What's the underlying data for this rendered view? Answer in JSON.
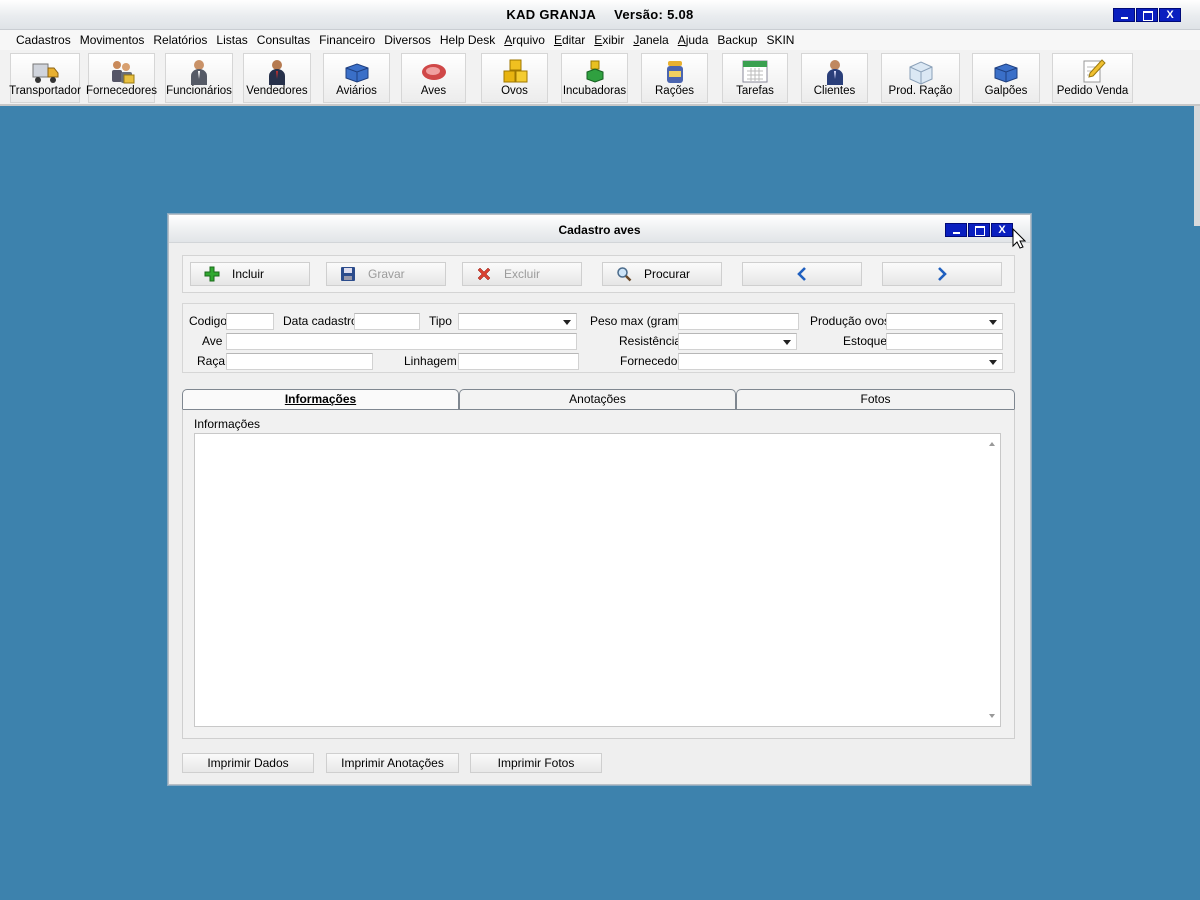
{
  "app": {
    "name": "KAD GRANJA",
    "version": "Versão: 5.08",
    "minimize_icon": "minimize-icon",
    "maximize_icon": "maximize-icon",
    "close_glyph": "X"
  },
  "menu": [
    "Cadastros",
    "Movimentos",
    "Relatórios",
    "Listas",
    "Consultas",
    "Financeiro",
    "Diversos",
    "Help Desk",
    "Arquivo",
    "Editar",
    "Exibir",
    "Janela",
    "Ajuda",
    "Backup",
    "SKIN"
  ],
  "toolbar": [
    {
      "label": "Transportador",
      "icon": "truck-icon"
    },
    {
      "label": "Fornecedores",
      "icon": "suppliers-icon"
    },
    {
      "label": "Funcionários",
      "icon": "employee-icon"
    },
    {
      "label": "Vendedores",
      "icon": "seller-icon"
    },
    {
      "label": "Aviários",
      "icon": "aviary-icon"
    },
    {
      "label": "Aves",
      "icon": "meat-icon"
    },
    {
      "label": "Ovos",
      "icon": "boxes-icon"
    },
    {
      "label": "Incubadoras",
      "icon": "incubator-icon"
    },
    {
      "label": "Rações",
      "icon": "feed-icon"
    },
    {
      "label": "Tarefas",
      "icon": "calendar-icon"
    },
    {
      "label": "Clientes",
      "icon": "client-icon"
    },
    {
      "label": "Prod. Ração",
      "icon": "feed-production-icon"
    },
    {
      "label": "Galpões",
      "icon": "warehouse-icon"
    },
    {
      "label": "Pedido Venda",
      "icon": "order-icon"
    }
  ],
  "window": {
    "title": "Cadastro aves",
    "close_glyph": "X"
  },
  "actions": {
    "incluir": "Incluir",
    "gravar": "Gravar",
    "excluir": "Excluir",
    "procurar": "Procurar"
  },
  "fields": {
    "codigo": {
      "label": "Codigo",
      "value": ""
    },
    "data_cadastro": {
      "label": "Data cadastro",
      "value": ""
    },
    "tipo": {
      "label": "Tipo",
      "value": ""
    },
    "peso_max": {
      "label": "Peso max (grama)",
      "value": ""
    },
    "producao_ovos": {
      "label": "Produção ovos",
      "value": ""
    },
    "ave": {
      "label": "Ave",
      "value": ""
    },
    "resistencia": {
      "label": "Resistência",
      "value": ""
    },
    "estoque": {
      "label": "Estoque",
      "value": ""
    },
    "raca": {
      "label": "Raça",
      "value": ""
    },
    "linhagem": {
      "label": "Linhagem",
      "value": ""
    },
    "fornecedor": {
      "label": "Fornecedor",
      "value": ""
    }
  },
  "tabs": {
    "informacoes": "Informações",
    "anotacoes": "Anotações",
    "fotos": "Fotos"
  },
  "info_panel": {
    "label": "Informações",
    "text": ""
  },
  "print": {
    "dados": "Imprimir Dados",
    "anotacoes": "Imprimir Anotações",
    "fotos": "Imprimir Fotos"
  }
}
